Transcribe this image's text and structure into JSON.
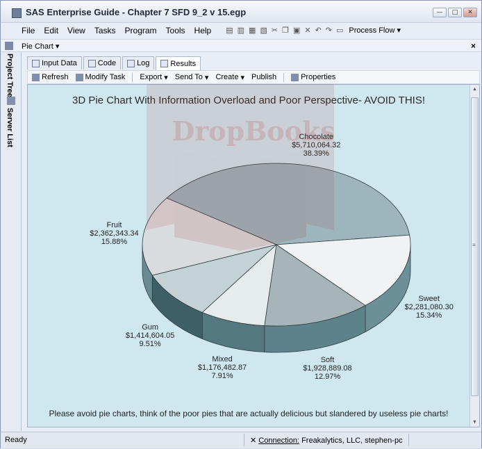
{
  "window": {
    "title": "SAS Enterprise Guide - Chapter 7 SFD 9_2 v 15.egp",
    "btn_min": "—",
    "btn_max": "□",
    "btn_close": "✕"
  },
  "menu": {
    "items": [
      "File",
      "Edit",
      "View",
      "Tasks",
      "Program",
      "Tools",
      "Help"
    ],
    "process_flow": "Process Flow"
  },
  "doc": {
    "title": "Pie Chart",
    "close": "×"
  },
  "sidebar": {
    "project_tree": "Project Tree",
    "server_list": "Server List"
  },
  "tabs": [
    "Input Data",
    "Code",
    "Log",
    "Results"
  ],
  "actions": [
    "Refresh",
    "Modify Task",
    "Export",
    "Send To",
    "Create",
    "Publish",
    "Properties"
  ],
  "chart_data": {
    "type": "pie",
    "title": "3D Pie Chart With Information Overload and Poor Perspective- AVOID THIS!",
    "footnote": "Please avoid pie charts, think of the poor pies that are actually delicious but slandered by useless pie charts!",
    "slices": [
      {
        "label": "Chocolate",
        "amount": "$5,710,064.32",
        "percent": "38.39%",
        "value": 38.39
      },
      {
        "label": "Sweet",
        "amount": "$2,281,080.30",
        "percent": "15.34%",
        "value": 15.34
      },
      {
        "label": "Soft",
        "amount": "$1,928,889.08",
        "percent": "12.97%",
        "value": 12.97
      },
      {
        "label": "Mixed",
        "amount": "$1,176,482.87",
        "percent": "7.91%",
        "value": 7.91
      },
      {
        "label": "Gum",
        "amount": "$1,414,604.05",
        "percent": "9.51%",
        "value": 9.51
      },
      {
        "label": "Fruit",
        "amount": "$2,362,343.34",
        "percent": "15.88%",
        "value": 15.88
      }
    ],
    "colors": {
      "top": [
        "#9db6bd",
        "#f1f2f3",
        "#a7b5b9",
        "#e6ecee",
        "#c4d2d6",
        "#d9dcde"
      ],
      "side": "#5a7e87"
    }
  },
  "watermark": {
    "text": "DropBooks"
  },
  "status": {
    "ready": "Ready",
    "connection_label": "Connection:",
    "connection_value": "Freakalytics, LLC, stephen-pc"
  }
}
